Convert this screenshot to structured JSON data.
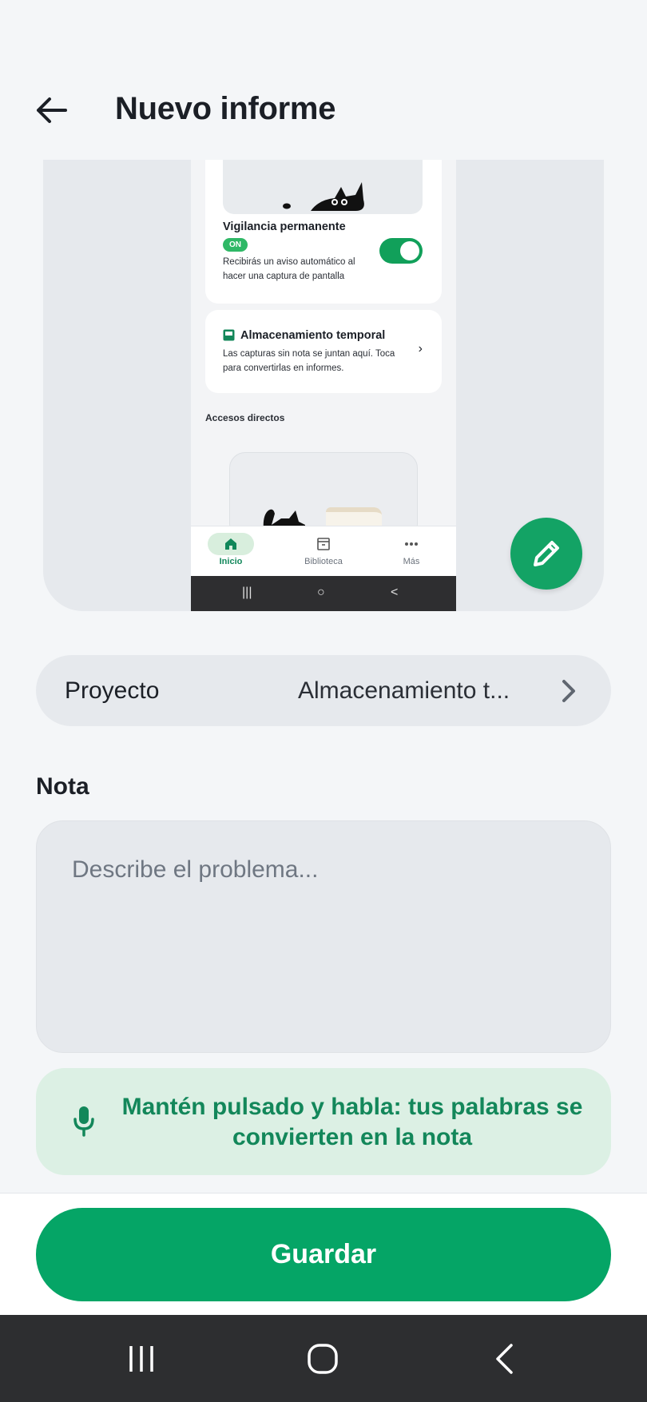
{
  "header": {
    "title": "Nuevo informe"
  },
  "preview": {
    "vigilance_title": "Vigilancia permanente",
    "vigilance_badge": "ON",
    "vigilance_desc": "Recibirás un aviso automático al hacer una captura de pantalla",
    "storage_title": "Almacenamiento temporal",
    "storage_desc": "Las capturas sin nota se juntan aquí. Toca para convertirlas en informes.",
    "shortcuts_label": "Accesos directos",
    "nav": [
      {
        "label": "Inicio",
        "icon": "home-icon"
      },
      {
        "label": "Biblioteca",
        "icon": "archive-icon"
      },
      {
        "label": "Más",
        "icon": "more-icon"
      }
    ]
  },
  "project": {
    "label": "Proyecto",
    "value": "Almacenamiento t..."
  },
  "note": {
    "label": "Nota",
    "placeholder": "Describe el problema..."
  },
  "voice": {
    "text": "Mantén pulsado y habla: tus palabras se convierten en la nota"
  },
  "save": {
    "label": "Guardar"
  },
  "colors": {
    "accent": "#05a566",
    "voice_bg": "#dcf0e4",
    "voice_text": "#13875a"
  }
}
